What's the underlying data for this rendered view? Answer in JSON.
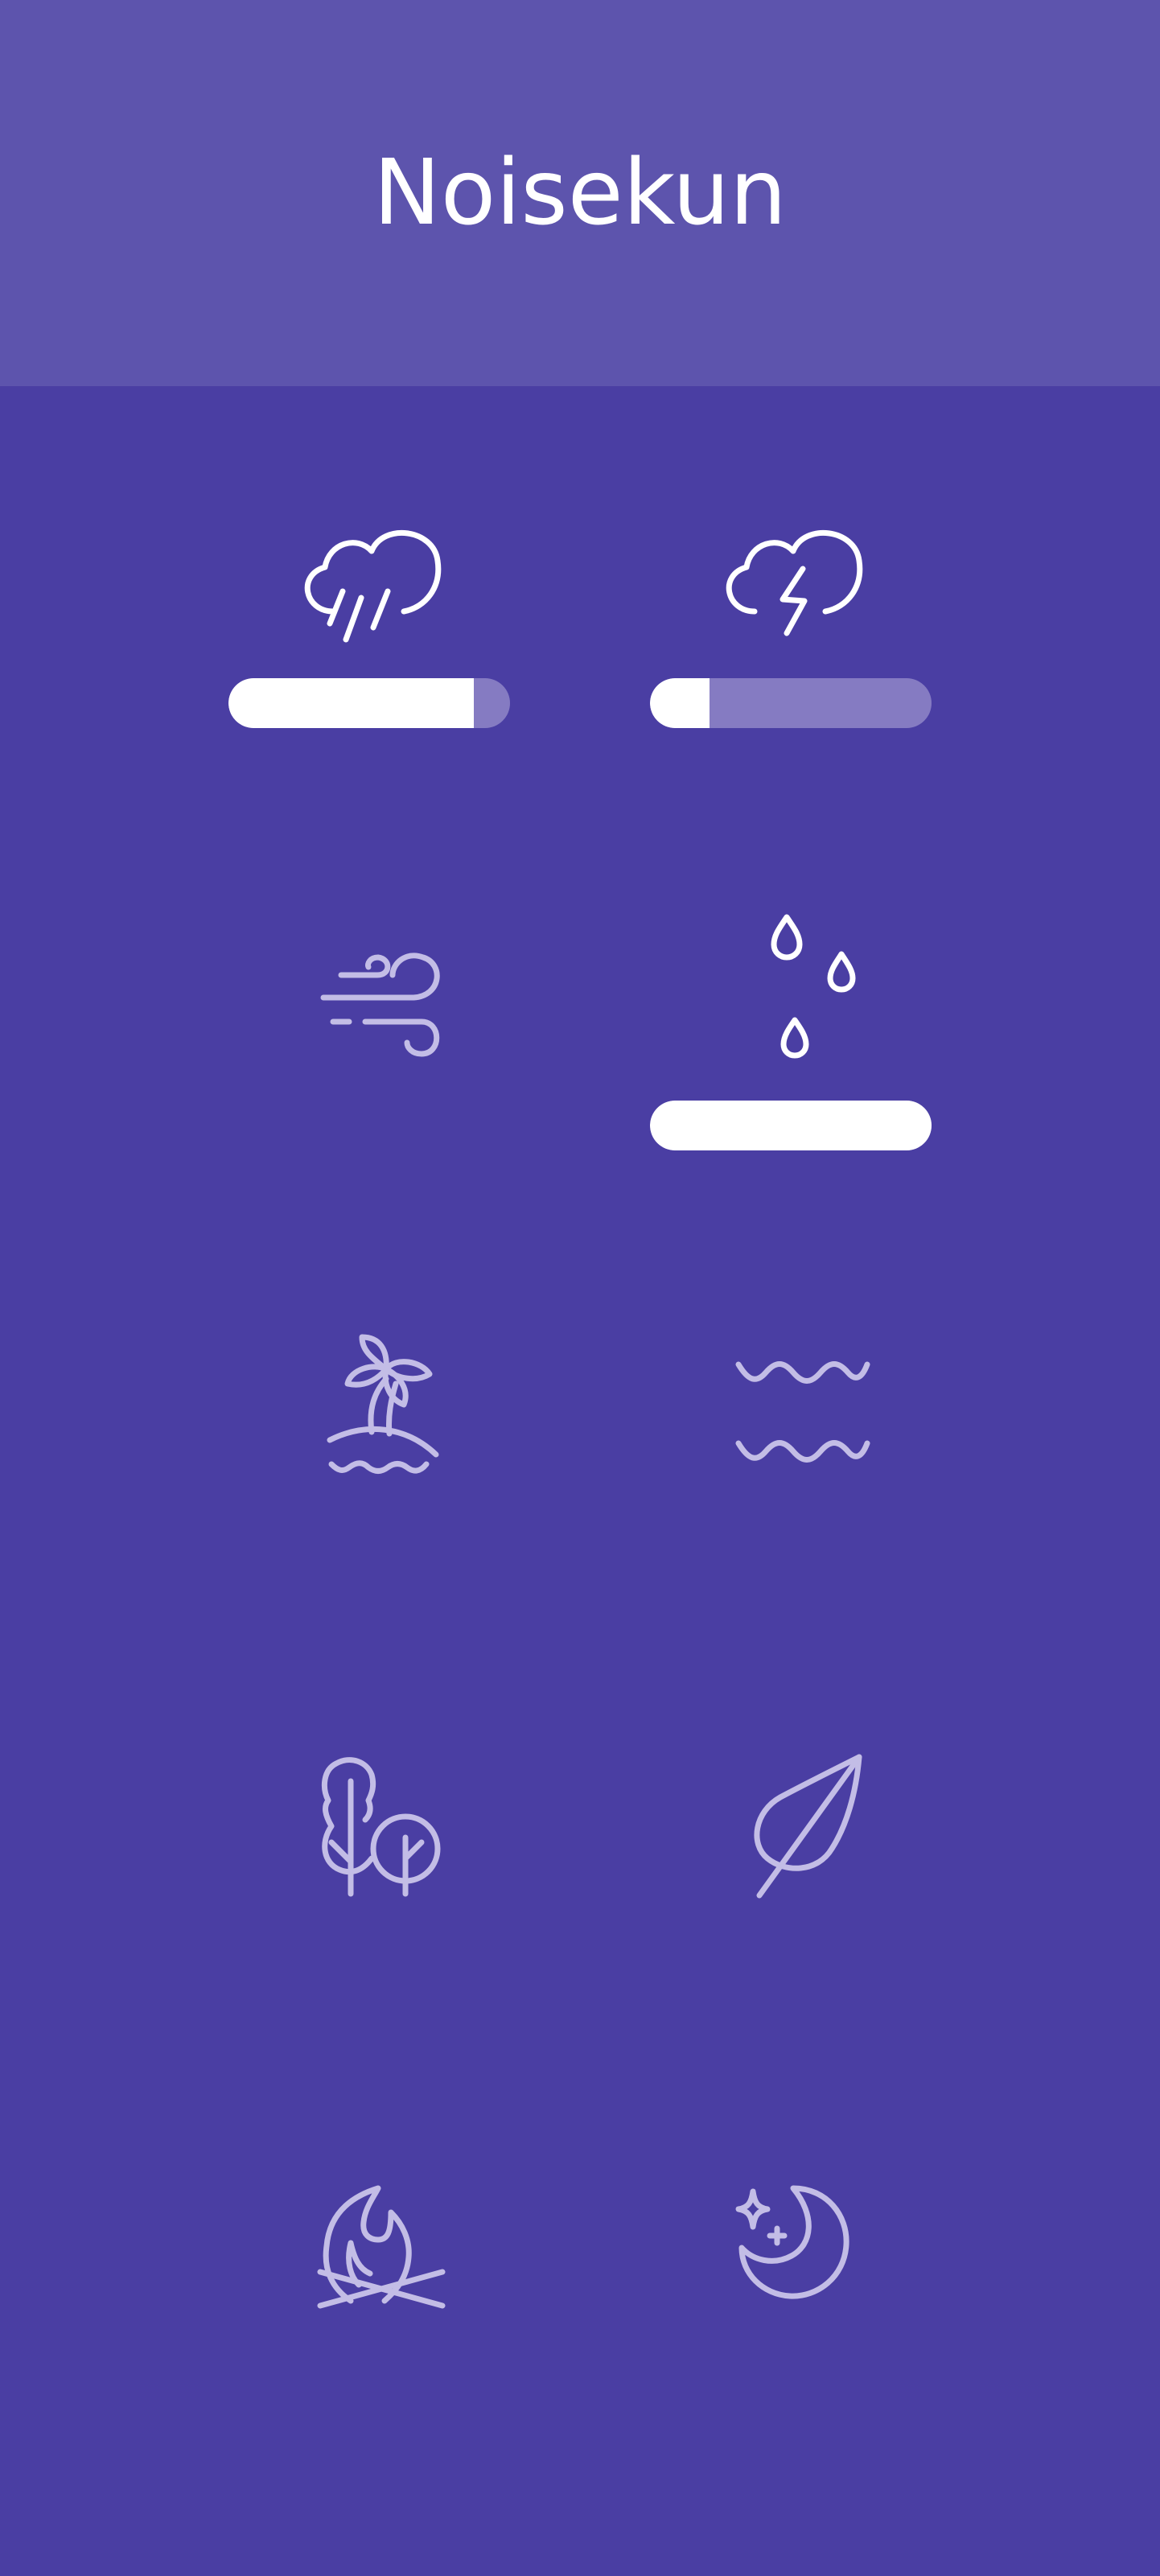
{
  "app": {
    "title": "Noisekun"
  },
  "colors": {
    "header_bg": "#5d54ad",
    "main_bg": "#4a3ea3",
    "active_icon": "#ffffff",
    "inactive_icon": "#c3bde6",
    "slider_track": "#857bc2",
    "slider_fill": "#ffffff"
  },
  "sounds": [
    {
      "icon": "cloud-rain-icon",
      "active": true,
      "volume": 0.87
    },
    {
      "icon": "cloud-lightning-icon",
      "active": true,
      "volume": 0.21
    },
    {
      "icon": "wind-icon",
      "active": false
    },
    {
      "icon": "raindrops-icon",
      "active": true,
      "volume": 1.0
    },
    {
      "icon": "island-palm-icon",
      "active": false
    },
    {
      "icon": "waves-icon",
      "active": false
    },
    {
      "icon": "trees-icon",
      "active": false
    },
    {
      "icon": "leaf-icon",
      "active": false
    },
    {
      "icon": "campfire-icon",
      "active": false
    },
    {
      "icon": "moon-stars-icon",
      "active": false
    }
  ]
}
